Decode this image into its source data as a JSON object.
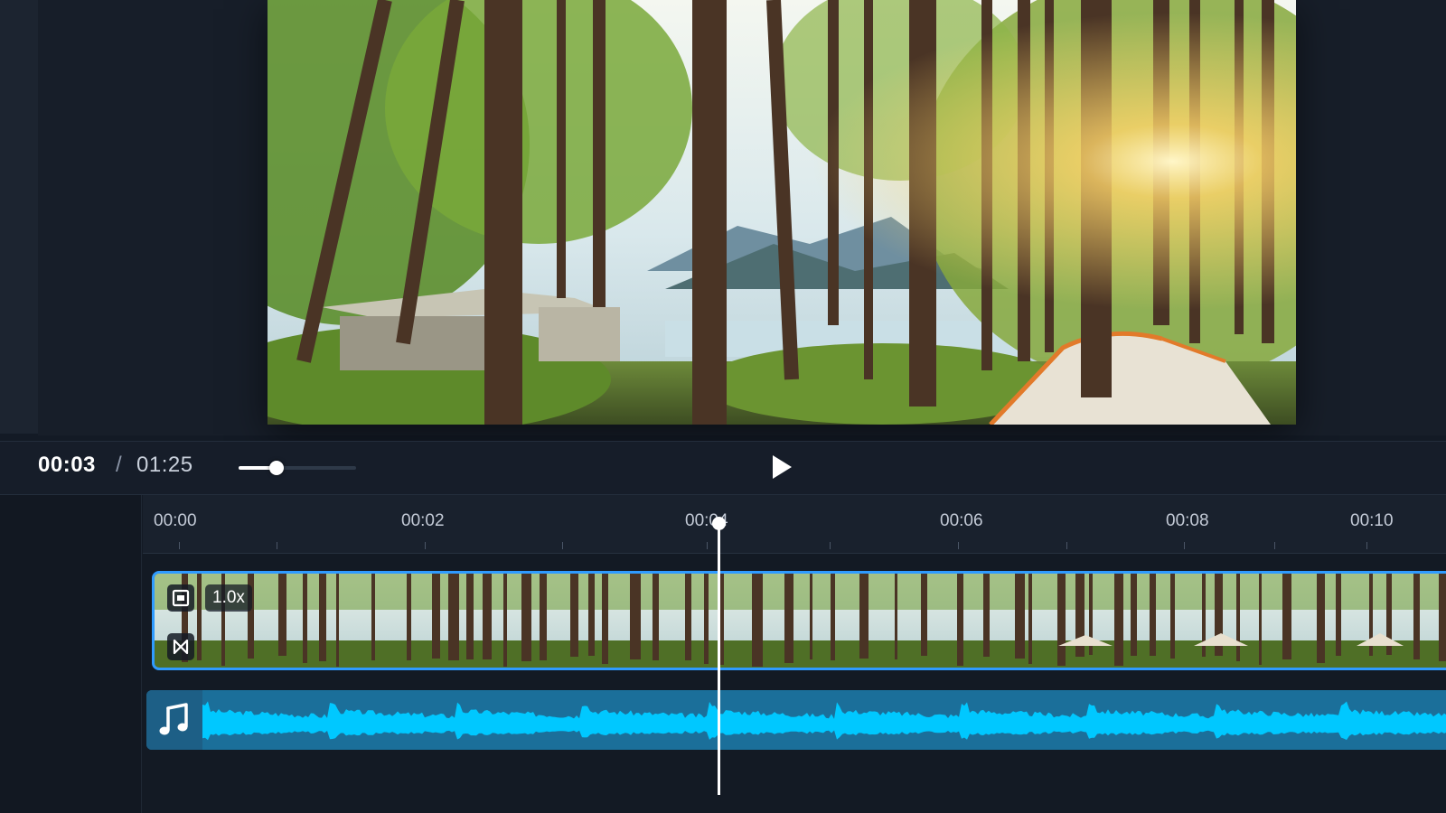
{
  "player": {
    "current_time": "00:03",
    "separator": "/",
    "total_time": "01:25",
    "zoom_level": 0.32
  },
  "ruler": {
    "labels": [
      "00:00",
      "00:02",
      "00:04",
      "00:06",
      "00:08",
      "00:10"
    ]
  },
  "video_track": {
    "speed": "1.0x"
  },
  "icons": {
    "play": "play-icon",
    "crop": "crop-icon",
    "transition": "transition-icon",
    "music": "music-note-icon"
  },
  "colors": {
    "clip_border": "#2f9bff",
    "waveform": "#00c8ff",
    "playhead": "#ffffff"
  }
}
